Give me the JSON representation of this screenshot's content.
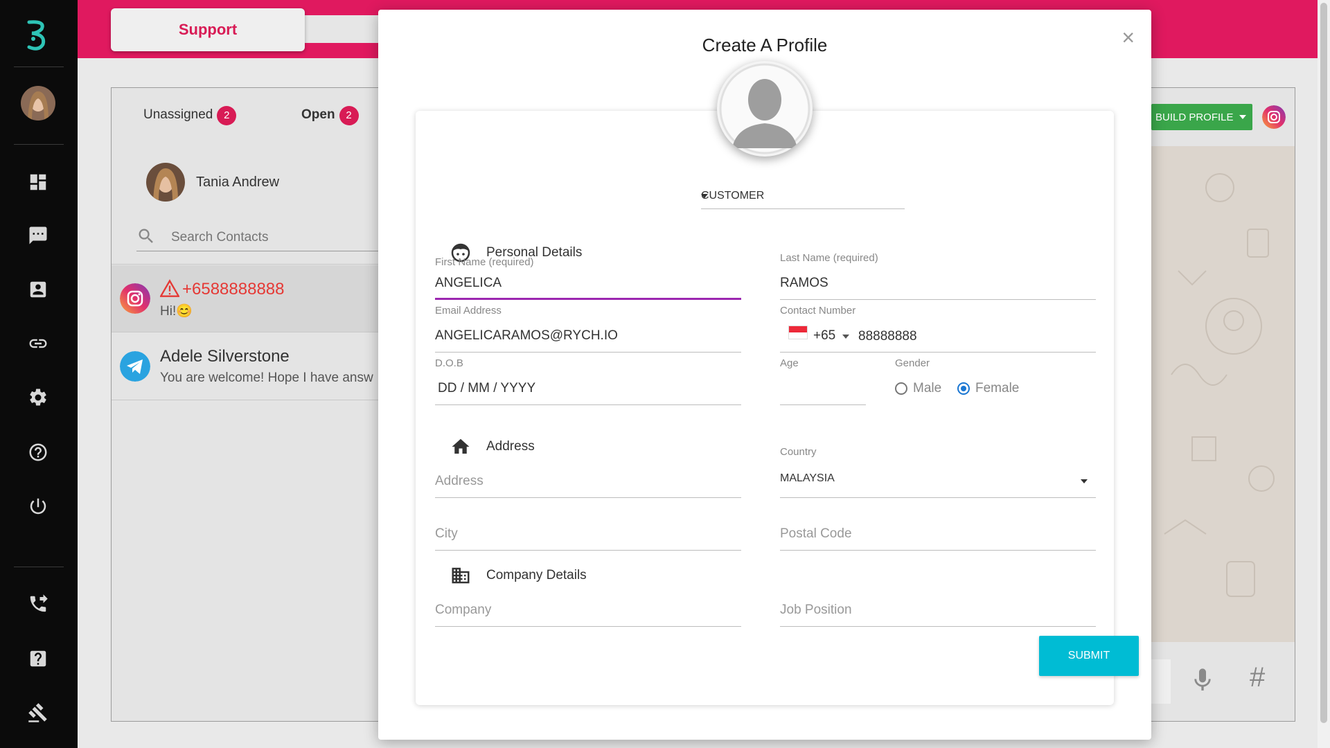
{
  "header": {
    "support_label": "Support"
  },
  "sidebar": {
    "items": [
      {
        "icon": "dashboard-icon"
      },
      {
        "icon": "chat-icon"
      },
      {
        "icon": "contacts-icon"
      },
      {
        "icon": "link-icon"
      },
      {
        "icon": "gear-icon"
      },
      {
        "icon": "help-icon"
      },
      {
        "icon": "power-icon"
      },
      {
        "icon": "phone-forward-icon"
      },
      {
        "icon": "question-box-icon"
      },
      {
        "icon": "gavel-icon"
      }
    ]
  },
  "inbox": {
    "tabs": [
      {
        "label": "Unassigned",
        "count": "2"
      },
      {
        "label": "Open",
        "count": "2"
      }
    ],
    "agent_name": "Tania Andrew",
    "search_placeholder": "Search Contacts",
    "contacts": [
      {
        "channel": "instagram",
        "name": "+6588888888",
        "message": "Hi!😊"
      },
      {
        "channel": "telegram",
        "name": "Adele Silverstone",
        "message": "You are welcome! Hope I have answ"
      }
    ]
  },
  "right_panel": {
    "build_profile_label": "BUILD PROFILE",
    "hash_label": "#"
  },
  "modal": {
    "title": "Create A Profile",
    "close_label": "×",
    "profile_type": "CUSTOMER",
    "sections": {
      "personal": "Personal Details",
      "address": "Address",
      "company": "Company Details"
    },
    "fields": {
      "first_name": {
        "label": "First Name (required)",
        "value": "ANGELICA"
      },
      "last_name": {
        "label": "Last Name (required)",
        "value": "RAMOS"
      },
      "email": {
        "label": "Email Address",
        "value": "ANGELICARAMOS@RYCH.IO"
      },
      "contact": {
        "label": "Contact Number",
        "dial_code": "+65",
        "value": "88888888"
      },
      "dob": {
        "label": "D.O.B",
        "value": "DD / MM / YYYY"
      },
      "age": {
        "label": "Age",
        "value": ""
      },
      "gender": {
        "label": "Gender",
        "options": [
          "Male",
          "Female"
        ],
        "selected": "Female"
      },
      "address": {
        "placeholder": "Address"
      },
      "country": {
        "label": "Country",
        "value": "MALAYSIA"
      },
      "city": {
        "placeholder": "City"
      },
      "postal_code": {
        "placeholder": "Postal Code"
      },
      "company": {
        "placeholder": "Company"
      },
      "job_position": {
        "placeholder": "Job Position"
      }
    },
    "submit_label": "SUBMIT"
  },
  "colors": {
    "brand_pink": "#e0195f",
    "badge": "#d81b55",
    "accent_purple": "#9c27b0",
    "submit": "#00bcd4",
    "build_green": "#3aa64a",
    "radio_blue": "#1976d2"
  }
}
